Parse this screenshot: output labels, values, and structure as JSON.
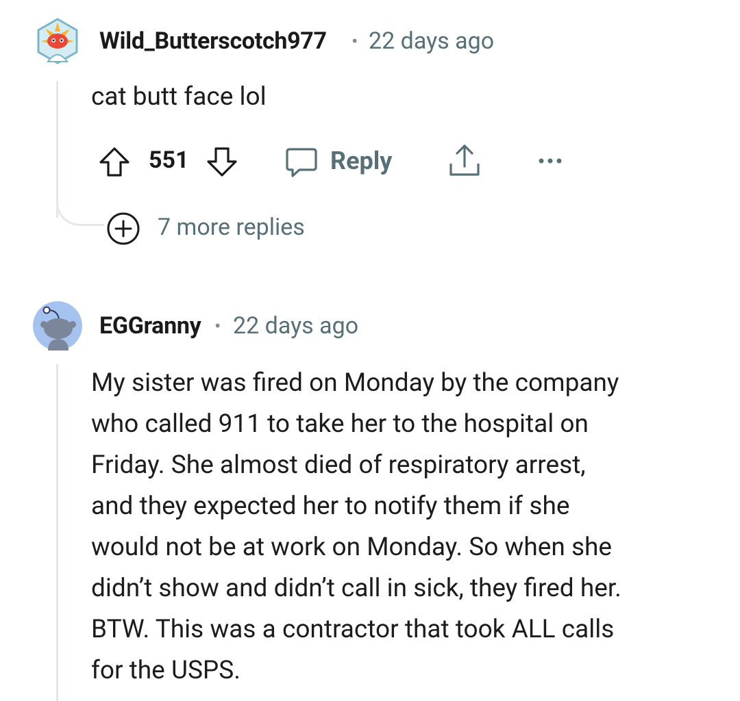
{
  "comments": [
    {
      "author": "Wild_Butterscotch977",
      "separator": "•",
      "time": "22 days ago",
      "body": "cat butt face lol",
      "score": "551",
      "reply_label": "Reply",
      "more_replies": "7 more replies",
      "icons": [
        "custom-avatar-icon",
        "upvote-icon",
        "downvote-icon",
        "comment-icon",
        "share-icon",
        "more-options-icon",
        "expand-plus-icon"
      ]
    },
    {
      "author": "EGGranny",
      "separator": "•",
      "time": "22 days ago",
      "body_lines": [
        "My sister was fired on Monday by the company",
        "who called 911 to take her to the hospital on",
        "Friday. She almost died of respiratory arrest,",
        "and they expected her to notify them if she",
        "would not be at work on Monday. So when she",
        "didn’t show and didn’t call in sick, they fired her.",
        "BTW. This was a contractor that took ALL calls",
        "for the USPS."
      ],
      "icons": [
        "default-snoo-avatar-icon"
      ]
    }
  ],
  "colors": {
    "text": "#1c1c1c",
    "meta": "#576f76",
    "thread_line": "#e5e8ea",
    "avatar2_bg": "#a6c3ef"
  }
}
